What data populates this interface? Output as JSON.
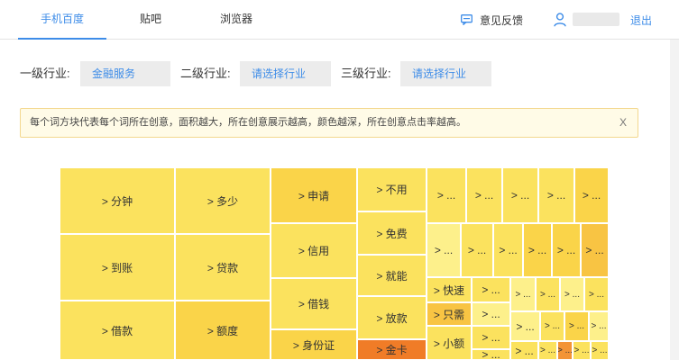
{
  "nav": {
    "tabs": [
      {
        "label": "手机百度",
        "active": true
      },
      {
        "label": "贴吧",
        "active": false
      },
      {
        "label": "浏览器",
        "active": false
      }
    ],
    "feedback_label": "意见反馈",
    "logout_label": "退出"
  },
  "filters": {
    "level1_label": "一级行业:",
    "level1_value": "金融服务",
    "level2_label": "二级行业:",
    "level2_value": "请选择行业",
    "level3_label": "三级行业:",
    "level3_value": "请选择行业"
  },
  "notice": {
    "text": "每个词方块代表每个词所在创意，面积越大，所在创意展示越高，颜色越深，所在创意点击率越高。",
    "close_label": "X"
  },
  "colors": {
    "accent": "#3d8ce8",
    "palette": [
      "#fdf08b",
      "#fbe25e",
      "#fad449",
      "#f8c443",
      "#f6a72c",
      "#f39436",
      "#f07c27"
    ]
  },
  "treemap": {
    "cells": [
      {
        "label": "> 分钟",
        "shade": 1
      },
      {
        "label": "> 到账",
        "shade": 1
      },
      {
        "label": "> 借款",
        "shade": 1
      },
      {
        "label": "> 多少",
        "shade": 1
      },
      {
        "label": "> 贷款",
        "shade": 1
      },
      {
        "label": "> 额度",
        "shade": 2
      },
      {
        "label": "> 申请",
        "shade": 2
      },
      {
        "label": "> 信用",
        "shade": 1
      },
      {
        "label": "> 借钱",
        "shade": 1
      },
      {
        "label": "> 身份证",
        "shade": 2
      },
      {
        "label": "> 不用",
        "shade": 1
      },
      {
        "label": "> 免费",
        "shade": 1
      },
      {
        "label": "> 就能",
        "shade": 1
      },
      {
        "label": "> 放款",
        "shade": 1
      },
      {
        "label": "> 金卡",
        "shade": 6
      },
      {
        "label": "> ...",
        "shade": 1
      },
      {
        "label": "> ...",
        "shade": 1
      },
      {
        "label": "> ...",
        "shade": 1
      },
      {
        "label": "> ...",
        "shade": 1
      },
      {
        "label": "> ...",
        "shade": 2
      },
      {
        "label": "> ...",
        "shade": 0
      },
      {
        "label": "> ...",
        "shade": 1
      },
      {
        "label": "> ...",
        "shade": 1
      },
      {
        "label": "> ...",
        "shade": 2
      },
      {
        "label": "> ...",
        "shade": 2
      },
      {
        "label": "> ...",
        "shade": 3
      },
      {
        "label": "> 快速",
        "shade": 1
      },
      {
        "label": "> ...",
        "shade": 1
      },
      {
        "label": "> ...",
        "shade": 0
      },
      {
        "label": "> ...",
        "shade": 1
      },
      {
        "label": "> ...",
        "shade": 0
      },
      {
        "label": "> ...",
        "shade": 1
      },
      {
        "label": "> 只需",
        "shade": 3
      },
      {
        "label": "> ...",
        "shade": 0
      },
      {
        "label": "> ...",
        "shade": 0
      },
      {
        "label": "> ...",
        "shade": 1
      },
      {
        "label": "> ...",
        "shade": 2
      },
      {
        "label": "> ...",
        "shade": 0
      },
      {
        "label": "> ...",
        "shade": 1
      },
      {
        "label": "> 小额",
        "shade": 1
      },
      {
        "label": "> ...",
        "shade": 1
      },
      {
        "label": "> ...",
        "shade": 1
      },
      {
        "label": "> ...",
        "shade": 1
      },
      {
        "label": "> ...",
        "shade": 5
      },
      {
        "label": "> ...",
        "shade": 1
      },
      {
        "label": "> ...",
        "shade": 1
      }
    ]
  }
}
